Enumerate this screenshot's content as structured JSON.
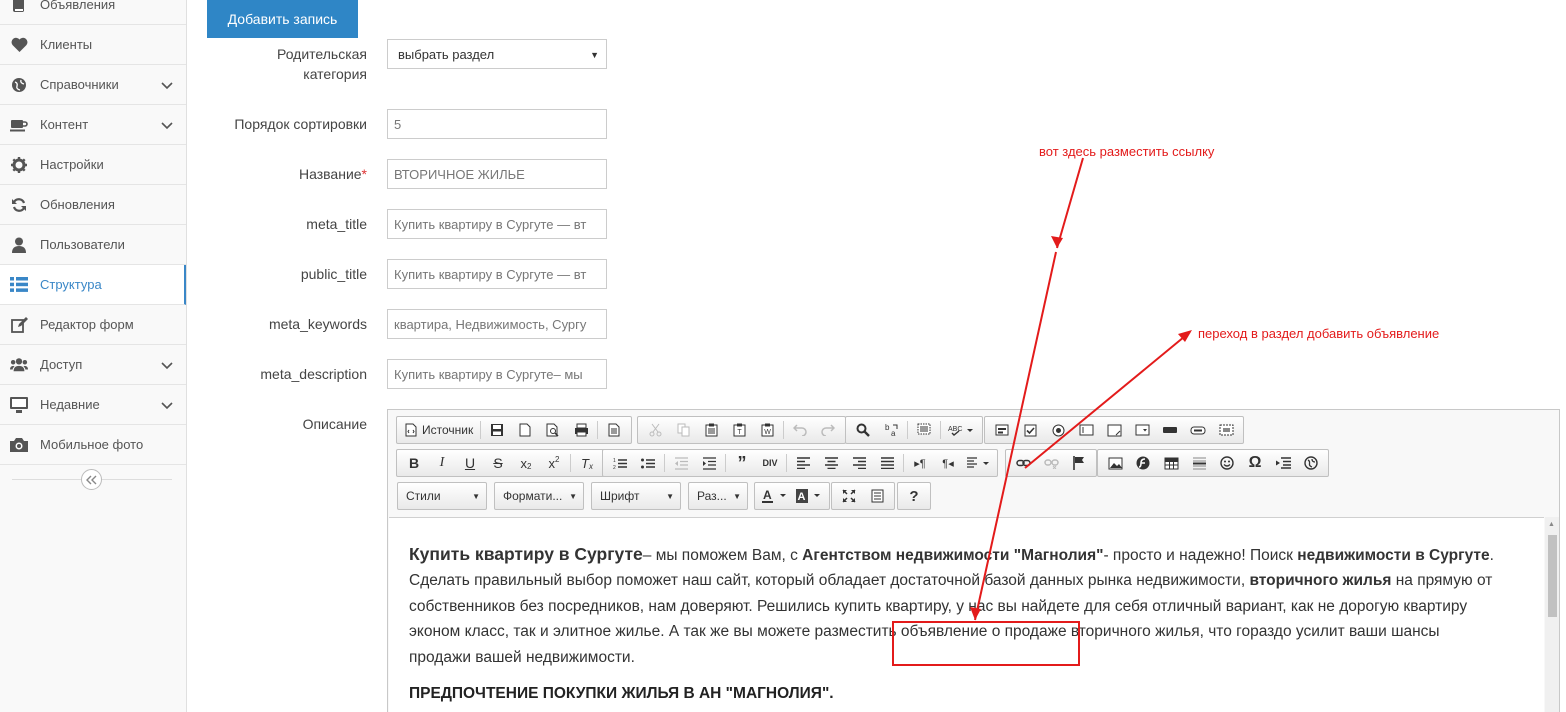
{
  "sidebar": {
    "items": [
      {
        "label": "Объявления",
        "icon": "book-icon",
        "chevron": false,
        "active": false
      },
      {
        "label": "Клиенты",
        "icon": "heart-icon",
        "chevron": false,
        "active": false
      },
      {
        "label": "Справочники",
        "icon": "globe-icon",
        "chevron": true,
        "active": false
      },
      {
        "label": "Контент",
        "icon": "coffee-icon",
        "chevron": true,
        "active": false
      },
      {
        "label": "Настройки",
        "icon": "gear-icon",
        "chevron": false,
        "active": false
      },
      {
        "label": "Обновления",
        "icon": "refresh-icon",
        "chevron": false,
        "active": false
      },
      {
        "label": "Пользователи",
        "icon": "user-icon",
        "chevron": false,
        "active": false
      },
      {
        "label": "Структура",
        "icon": "list-icon",
        "chevron": false,
        "active": true
      },
      {
        "label": "Редактор форм",
        "icon": "edit-icon",
        "chevron": false,
        "active": false
      },
      {
        "label": "Доступ",
        "icon": "users-icon",
        "chevron": true,
        "active": false
      },
      {
        "label": "Недавние",
        "icon": "monitor-icon",
        "chevron": true,
        "active": false
      },
      {
        "label": "Мобильное фото",
        "icon": "camera-icon",
        "chevron": false,
        "active": false
      }
    ],
    "collapse_icon": "double-chevron-left-icon"
  },
  "form": {
    "add_button": "Добавить запись",
    "parent_label_1": "Родительская",
    "parent_label_2": "категория",
    "parent_value": "выбрать раздел",
    "sort_label": "Порядок сортировки",
    "sort_value": "5",
    "name_label": "Название",
    "name_required": "*",
    "name_value": "ВТОРИЧНОЕ ЖИЛЬЕ",
    "meta_title_label": "meta_title",
    "meta_title_value": "Купить квартиру в Сургуте — вт",
    "public_title_label": "public_title",
    "public_title_value": "Купить квартиру в Сургуте — вт",
    "meta_keywords_label": "meta_keywords",
    "meta_keywords_value": "квартира, Недвижимость, Сургу",
    "meta_description_label": "meta_description",
    "meta_description_value": "Купить квартиру в Сургуте– мы",
    "description_label": "Описание"
  },
  "editor": {
    "source_label": "Источник",
    "styles_label": "Стили",
    "format_label": "Формати...",
    "font_label": "Шрифт",
    "size_label": "Раз...",
    "help_label": "?",
    "text": {
      "p1_bold1": "Купить квартиру в Сургуте",
      "p1_t1": "– мы поможем Вам, с ",
      "p1_bold2": "Агентством недвижимости \"Магнолия\"",
      "p1_t2": "- просто и надежно! Поиск ",
      "p1_bold3": "недвижимости в Сургуте",
      "p1_t3": ". Сделать правильный выбор поможет наш сайт, который обладает достаточной базой данных рынка недвижимости, ",
      "p1_bold4": "вторичного жилья",
      "p1_t4": " на прямую от собственников без посредников, нам доверяют. Решились купить квартиру, у нас вы найдете для себя отличный вариант, как не дорогую квартиру эконом класс, так и элитное жилье. А так же вы можете разместить объявление о продаже вторичного жилья, что гораздо усилит ваши шансы продажи вашей недвижимости.",
      "heading": "ПРЕДПОЧТЕНИЕ ПОКУПКИ ЖИЛЬЯ В АН \"МАГНОЛИЯ\"."
    }
  },
  "annotations": {
    "note1": "вот здесь разместить ссылку",
    "note2": "переход в раздел добавить объявление",
    "color": "#e31b1b"
  }
}
